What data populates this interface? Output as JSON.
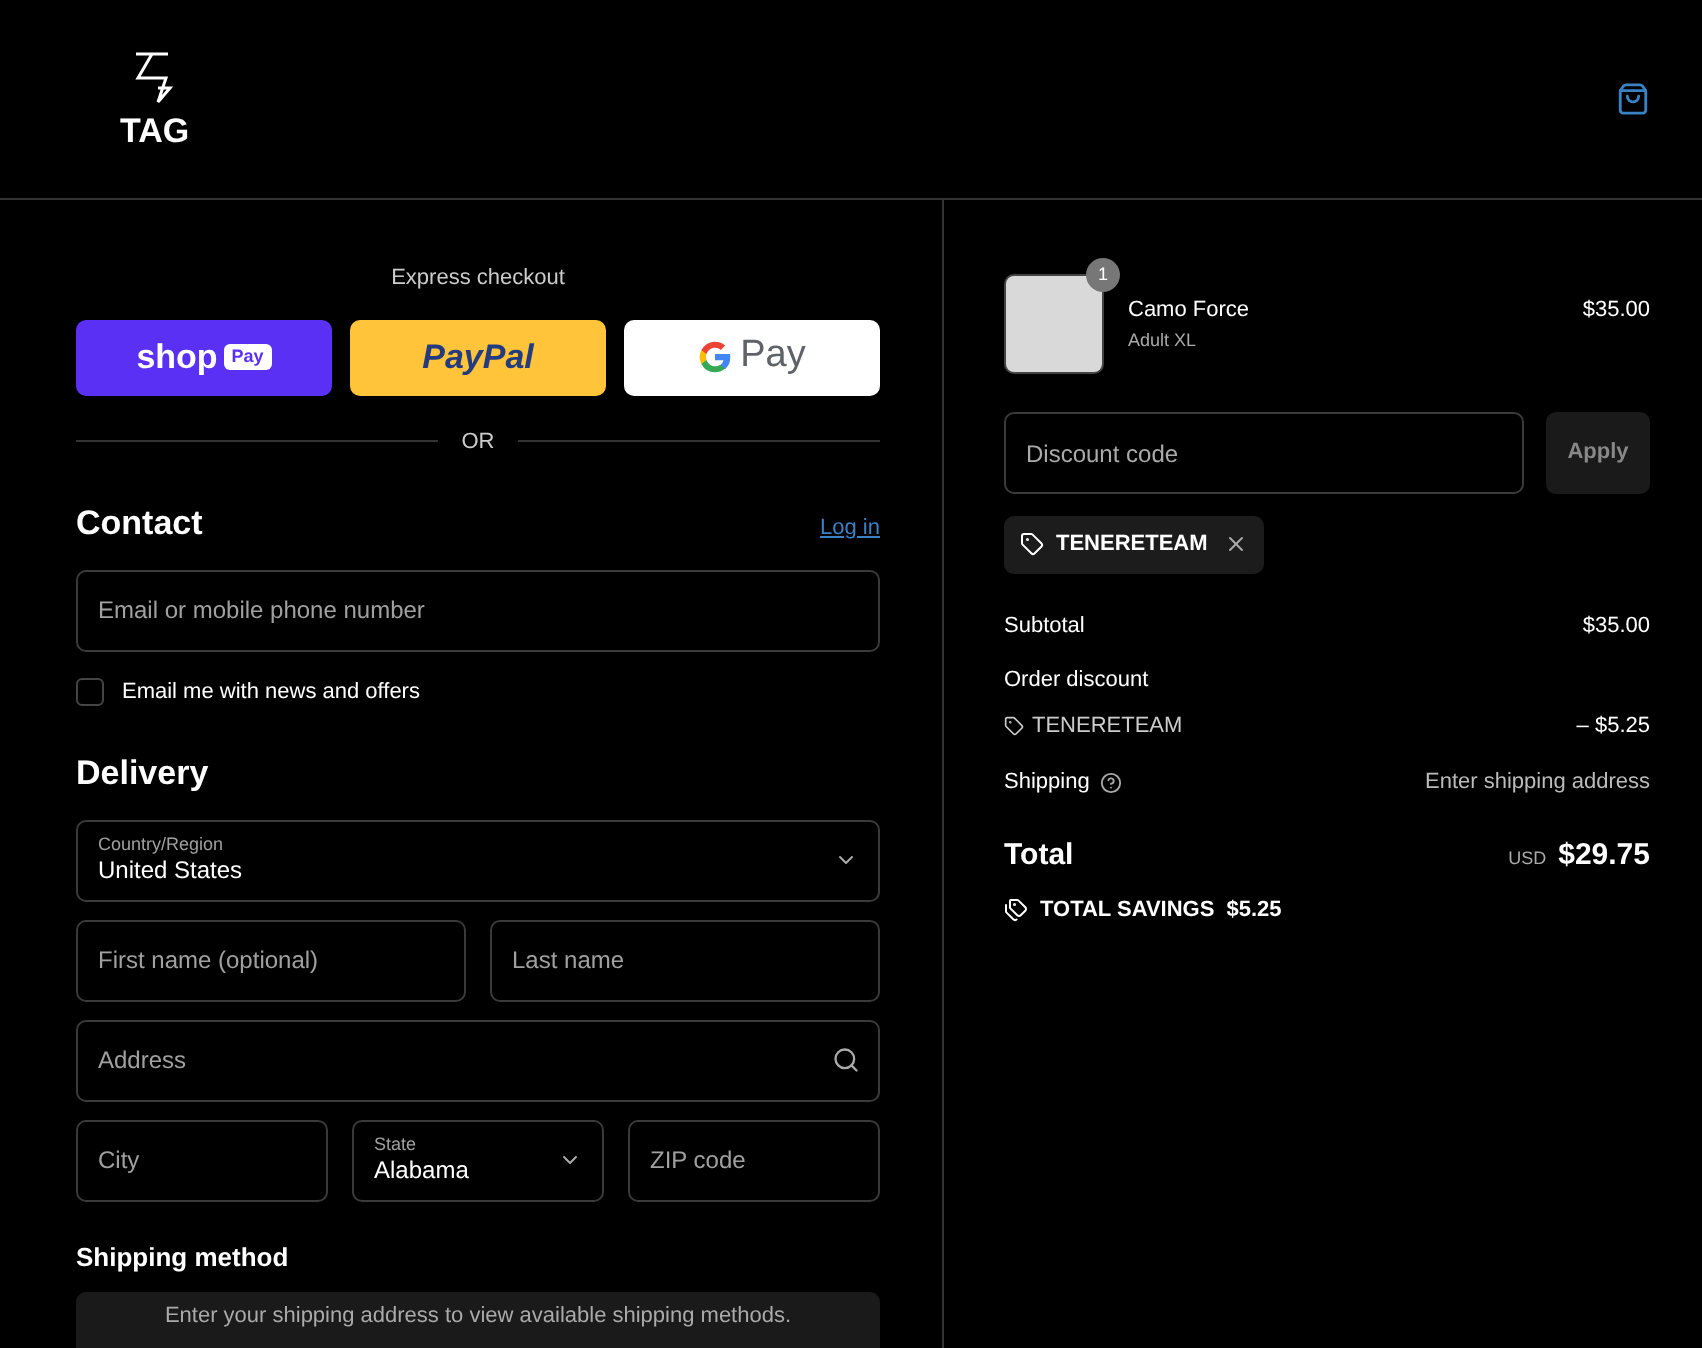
{
  "header": {
    "logo_text": "TAG"
  },
  "express_checkout": {
    "title": "Express checkout",
    "buttons": [
      {
        "kind": "shop",
        "word": "shop",
        "badge": "Pay"
      },
      {
        "kind": "paypal",
        "word": "PayPal"
      },
      {
        "kind": "gpay",
        "word": "Pay"
      }
    ],
    "divider": "OR"
  },
  "contact": {
    "title": "Contact",
    "login": "Log in",
    "email": {
      "placeholder": "Email or mobile phone number"
    },
    "newsletter": {
      "label": "Email me with news and offers",
      "checked": false
    }
  },
  "delivery": {
    "title": "Delivery",
    "country": {
      "label": "Country/Region",
      "value": "United States"
    },
    "rows": [
      [
        {
          "kind": "input",
          "placeholder": "First name (optional)"
        },
        {
          "kind": "input",
          "placeholder": "Last name"
        }
      ],
      [
        {
          "kind": "search",
          "placeholder": "Address"
        }
      ],
      [
        {
          "kind": "input",
          "placeholder": "City"
        },
        {
          "kind": "select",
          "label": "State",
          "value": "Alabama"
        },
        {
          "kind": "input",
          "placeholder": "ZIP code"
        }
      ]
    ]
  },
  "shipping_method": {
    "title": "Shipping method",
    "note": "Enter your shipping address to view available shipping methods."
  },
  "summary": {
    "item": {
      "name": "Camo Force",
      "variant": "Adult XL",
      "quantity": "1",
      "price": "$35.00"
    },
    "discount": {
      "placeholder": "Discount code",
      "apply": "Apply",
      "applied_code": "TENERETEAM"
    },
    "subtotal": {
      "label": "Subtotal",
      "value": "$35.00"
    },
    "order_discount": {
      "label": "Order discount",
      "code": "TENERETEAM",
      "value": "– $5.25"
    },
    "shipping": {
      "label": "Shipping",
      "value": "Enter shipping address"
    },
    "total": {
      "label": "Total",
      "currency": "USD",
      "value": "$29.75"
    },
    "savings": {
      "label": "TOTAL SAVINGS",
      "value": "$5.25"
    }
  }
}
